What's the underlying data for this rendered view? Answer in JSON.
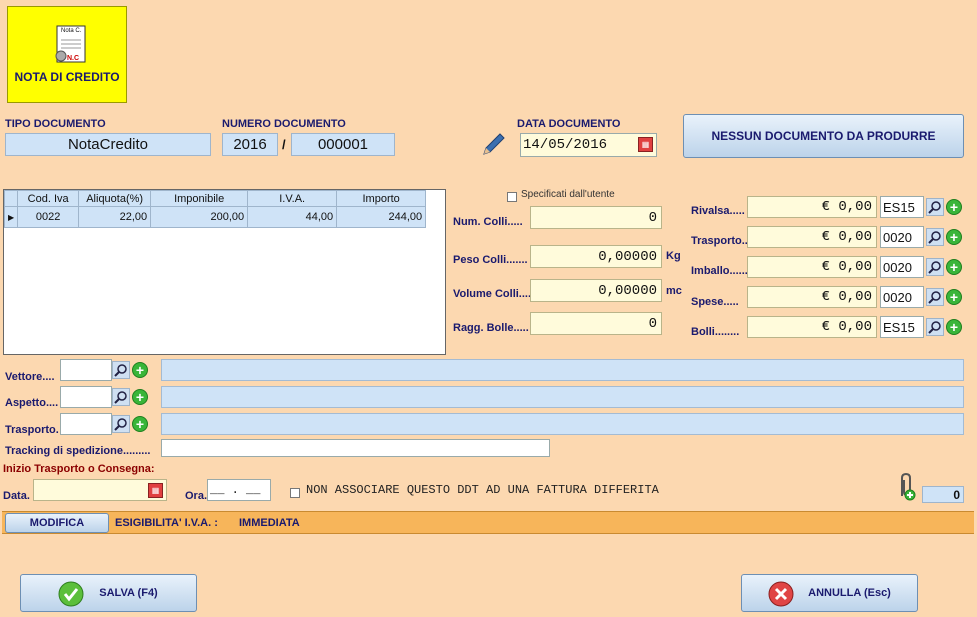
{
  "logo": {
    "caption": "NOTA DI CREDITO",
    "icon_top": "Nota C.",
    "icon_bottom": "N.C"
  },
  "header": {
    "tipo_label": "TIPO DOCUMENTO",
    "tipo_value": "NotaCredito",
    "numero_label": "NUMERO DOCUMENTO",
    "anno": "2016",
    "sep": "/",
    "numero": "000001",
    "data_label": "DATA DOCUMENTO",
    "data_value": "14/05/2016",
    "nessun_button": "NESSUN DOCUMENTO DA PRODURRE"
  },
  "iva_table": {
    "columns": [
      "Cod. Iva",
      "Aliquota(%)",
      "Imponibile",
      "I.V.A.",
      "Importo"
    ],
    "rows": [
      [
        "0022",
        "22,00",
        "200,00",
        "44,00",
        "244,00"
      ]
    ]
  },
  "colli": {
    "specificati_label": "Specificati dall'utente",
    "num_label": "Num. Colli.....",
    "num_value": "0",
    "peso_label": "Peso Colli.......",
    "peso_value": "0,00000",
    "peso_unit": "Kg",
    "volume_label": "Volume Colli....",
    "volume_value": "0,00000",
    "volume_unit": "mc",
    "ragg_label": "Ragg. Bolle.....",
    "ragg_value": "0"
  },
  "spese": {
    "rivalsa_label": "Rivalsa.....",
    "rivalsa_value": "€ 0,00",
    "rivalsa_code": "ES15",
    "trasporto_label": "Trasporto.......",
    "trasporto_value": "€ 0,00",
    "trasporto_code": "0020",
    "imballo_label": "Imballo.......",
    "imballo_value": "€ 0,00",
    "imballo_code": "0020",
    "spese_label": "Spese.....",
    "spese_value": "€ 0,00",
    "spese_code": "0020",
    "bolli_label": "Bolli........",
    "bolli_value": "€ 0,00",
    "bolli_code": "ES15"
  },
  "shipping": {
    "vettore_label": "Vettore....",
    "aspetto_label": "Aspetto....",
    "trasporto_label": "Trasporto.",
    "tracking_label": "Tracking di spedizione.........",
    "inizio_label": "Inizio Trasporto o Consegna:",
    "data_label": "Data.",
    "ora_label": "Ora.",
    "ora_value": "__ . __",
    "non_associare_label": "NON ASSOCIARE QUESTO DDT AD UNA FATTURA DIFFERITA",
    "attach_count": "0"
  },
  "status": {
    "modifica_button": "MODIFICA",
    "esigibilita_label": "ESIGIBILITA' I.V.A. :",
    "esigibilita_value": "IMMEDIATA"
  },
  "actions": {
    "salva_button": "SALVA (F4)",
    "annulla_button": "ANNULLA (Esc)"
  }
}
